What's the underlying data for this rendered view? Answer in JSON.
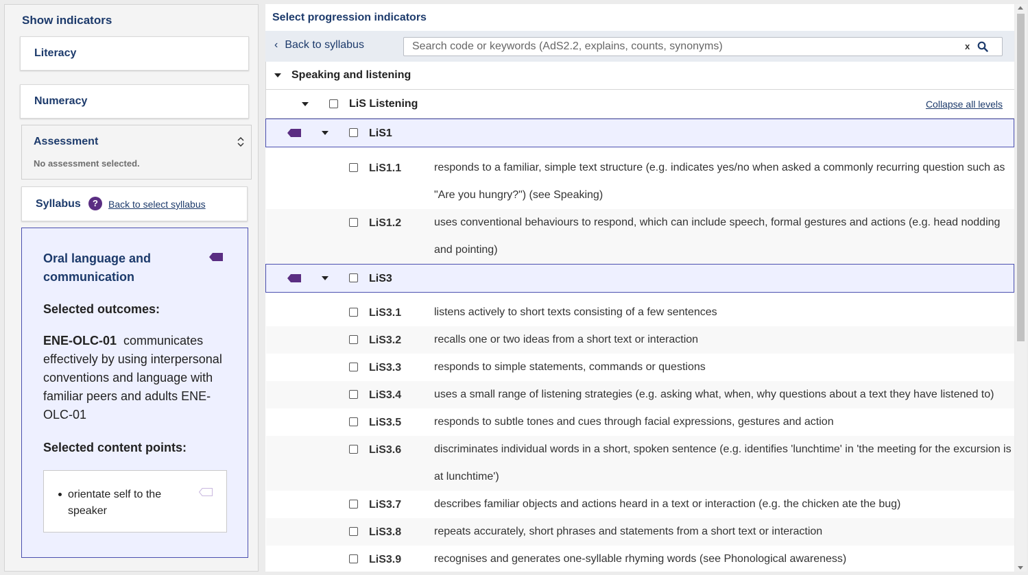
{
  "left": {
    "title": "Show indicators",
    "literacy": "Literacy",
    "numeracy": "Numeracy",
    "assessment": {
      "label": "Assessment",
      "status": "No assessment selected."
    },
    "syllabus": {
      "label": "Syllabus",
      "help": "?",
      "back": "Back to select syllabus"
    },
    "outcome": {
      "name": "Oral language and communication",
      "selected_outcomes_heading": "Selected outcomes:",
      "outcome_code": "ENE-OLC-01",
      "outcome_text": "communicates effectively by using interpersonal conventions and language with familiar peers and adults ENE-OLC-01",
      "selected_content_heading": "Selected content points:",
      "content_point": "orientate self to the speaker"
    }
  },
  "right": {
    "title": "Select progression indicators",
    "back": "Back to syllabus",
    "search": {
      "placeholder": "Search code or keywords (AdS2.2, explains, counts, synonyms)",
      "clear": "x"
    },
    "section": "Speaking and listening",
    "list": {
      "label": "LiS Listening",
      "collapse": "Collapse all levels"
    },
    "levels": [
      {
        "label": "LiS1",
        "indicators": [
          {
            "code": "LiS1.1",
            "text": "responds to a familiar, simple text structure (e.g. indicates yes/no when asked a commonly recurring question such as \"Are you hungry?\") (see Speaking)"
          },
          {
            "code": "LiS1.2",
            "text": "uses conventional behaviours to respond, which can include speech, formal gestures and actions (e.g. head nodding and pointing)"
          }
        ]
      },
      {
        "label": "LiS3",
        "indicators": [
          {
            "code": "LiS3.1",
            "text": "listens actively to short texts consisting of a few sentences"
          },
          {
            "code": "LiS3.2",
            "text": "recalls one or two ideas from a short text or interaction"
          },
          {
            "code": "LiS3.3",
            "text": "responds to simple statements, commands or questions"
          },
          {
            "code": "LiS3.4",
            "text": "uses a small range of listening strategies (e.g. asking what, when, why questions about a text they have listened to)"
          },
          {
            "code": "LiS3.5",
            "text": "responds to subtle tones and cues through facial expressions, gestures and action"
          },
          {
            "code": "LiS3.6",
            "text": "discriminates individual words in a short, spoken sentence (e.g. identifies 'lunchtime' in 'the meeting for the excursion is at lunchtime')"
          },
          {
            "code": "LiS3.7",
            "text": "describes familiar objects and actions heard in a text or interaction (e.g. the chicken ate the bug)"
          },
          {
            "code": "LiS3.8",
            "text": "repeats accurately, short phrases and statements from a short text or interaction"
          },
          {
            "code": "LiS3.9",
            "text": "recognises and generates one-syllable rhyming words (see Phonological awareness)"
          }
        ]
      }
    ]
  },
  "colors": {
    "accent": "#5a2d82",
    "navy": "#1c3a6b",
    "level_bg": "#eef0ff",
    "level_border": "#4a4faf"
  }
}
